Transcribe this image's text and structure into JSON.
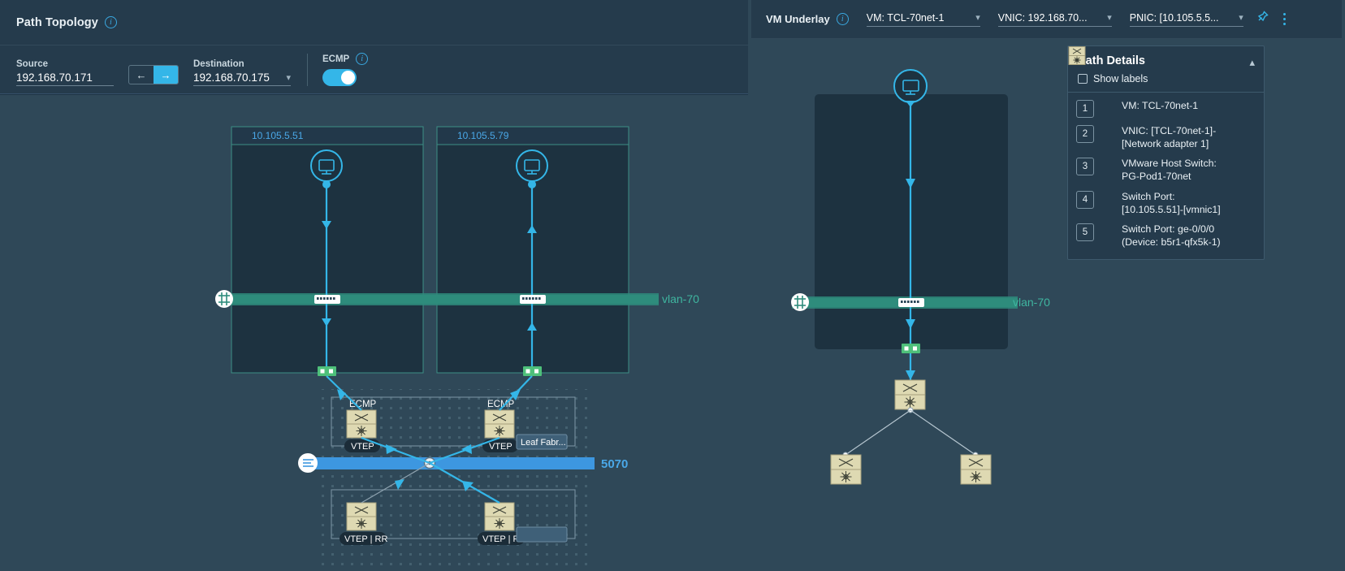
{
  "left": {
    "title": "Path Topology",
    "info_icon": "info-icon",
    "source": {
      "label": "Source",
      "value": "192.168.70.171"
    },
    "direction": {
      "back": "←",
      "forward": "→",
      "active": "forward"
    },
    "destination": {
      "label": "Destination",
      "value": "192.168.70.175"
    },
    "ecmp": {
      "label": "ECMP",
      "enabled": true
    },
    "topology": {
      "hosts": [
        {
          "name": "10.105.5.51"
        },
        {
          "name": "10.105.5.79"
        }
      ],
      "vlan_label": "vlan-70",
      "fabric_label": "5070",
      "leaf_group_label": "Leaf Fabr...",
      "ecmp_labels": [
        "ECMP",
        "ECMP"
      ],
      "vtep_labels": [
        "VTEP",
        "VTEP"
      ],
      "vtep_rr_labels": [
        "VTEP | RR",
        "VTEP | RR"
      ]
    }
  },
  "right": {
    "title": "VM Underlay",
    "selectors": [
      {
        "name": "vm-selector",
        "value": "VM: TCL-70net-1"
      },
      {
        "name": "vnic-selector",
        "value": "VNIC: 192.168.70..."
      },
      {
        "name": "pnic-selector",
        "value": "PNIC: [10.105.5.5..."
      }
    ],
    "pin_icon": "pin-icon",
    "menu_icon": "kebab-menu-icon",
    "topology": {
      "vlan_label": "vlan-70"
    },
    "details": {
      "title": "Path Details",
      "show_labels": {
        "label": "Show labels",
        "checked": false
      },
      "collapse_icon": "chevron-up-icon",
      "steps": [
        {
          "num": "1",
          "icon": "vm-icon",
          "lines": [
            "VM: TCL-70net-1"
          ]
        },
        {
          "num": "2",
          "icon": "vnic-dot-icon",
          "lines": [
            "VNIC: [TCL-70net-1]-",
            "[Network adapter 1]"
          ]
        },
        {
          "num": "3",
          "icon": "host-switch-icon",
          "lines": [
            "VMware Host Switch:",
            "PG-Pod1-70net"
          ]
        },
        {
          "num": "4",
          "icon": "switch-port-icon",
          "lines": [
            "Switch Port:",
            "[10.105.5.51]-[vmnic1]"
          ]
        },
        {
          "num": "5",
          "icon": "router-icon",
          "lines": [
            "Switch Port: ge-0/0/0",
            "(Device: b5r1-qfx5k-1)"
          ]
        }
      ]
    }
  },
  "colors": {
    "accent_blue": "#34b6e8",
    "vlan_green": "#2e8c7c",
    "fabric_blue": "#3d97e0",
    "panel_bg": "#253b4c",
    "canvas_bg": "#2f4858",
    "host_box": "#1d3240",
    "node_tan": "#ded9b2"
  }
}
